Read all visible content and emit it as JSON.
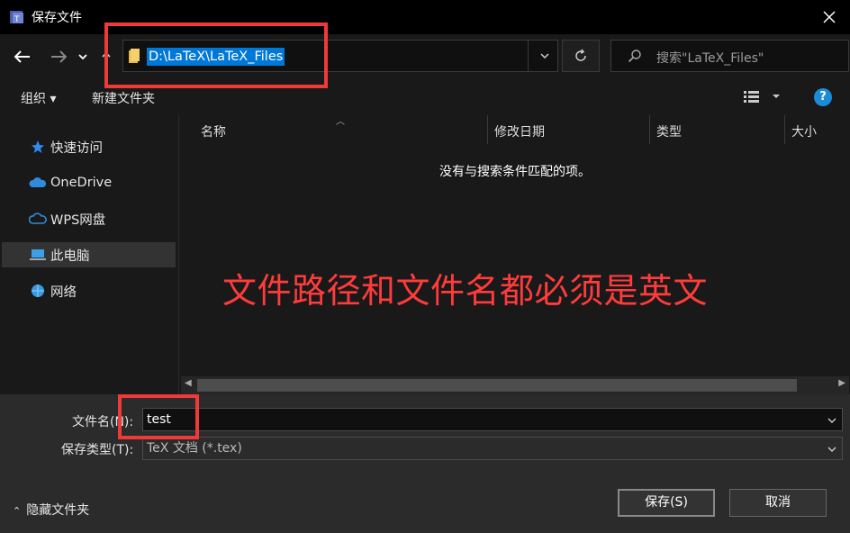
{
  "window": {
    "title": "保存文件",
    "close_icon": "close-icon"
  },
  "nav": {
    "back_icon": "arrow-left-icon",
    "forward_icon": "arrow-right-icon",
    "recent_icon": "chevron-down-icon",
    "up_icon": "arrow-up-icon"
  },
  "address": {
    "path": "D:\\LaTeX\\LaTeX_Files",
    "folder_icon": "folder-icon",
    "dropdown_icon": "chevron-down-icon",
    "refresh_icon": "refresh-icon"
  },
  "search": {
    "placeholder": "搜索\"LaTeX_Files\"",
    "icon": "search-icon"
  },
  "toolbar": {
    "organize_label": "组织 ▾",
    "new_folder_label": "新建文件夹",
    "view_icon": "view-options-icon",
    "help_label": "?"
  },
  "sidebar": {
    "items": [
      {
        "label": "快速访问",
        "icon": "star-icon"
      },
      {
        "label": "OneDrive",
        "icon": "cloud-icon"
      },
      {
        "label": "WPS网盘",
        "icon": "cloud-outline-icon"
      },
      {
        "label": "此电脑",
        "icon": "computer-icon"
      },
      {
        "label": "网络",
        "icon": "network-icon"
      }
    ]
  },
  "columns": [
    "名称",
    "修改日期",
    "类型",
    "大小"
  ],
  "empty_message": "没有与搜索条件匹配的项。",
  "annotation_text": "文件路径和文件名都必须是英文",
  "footer": {
    "filename_label": "文件名(N):",
    "filename_value": "test",
    "filetype_label": "保存类型(T):",
    "filetype_value": "TeX 文档 (*.tex)",
    "hide_folders_label": "隐藏文件夹",
    "save_label": "保存(S)",
    "cancel_label": "取消"
  },
  "colors": {
    "annotation": "#ff3b3b",
    "selection": "#0078d7",
    "highlight_box": "#ef3a3a"
  }
}
